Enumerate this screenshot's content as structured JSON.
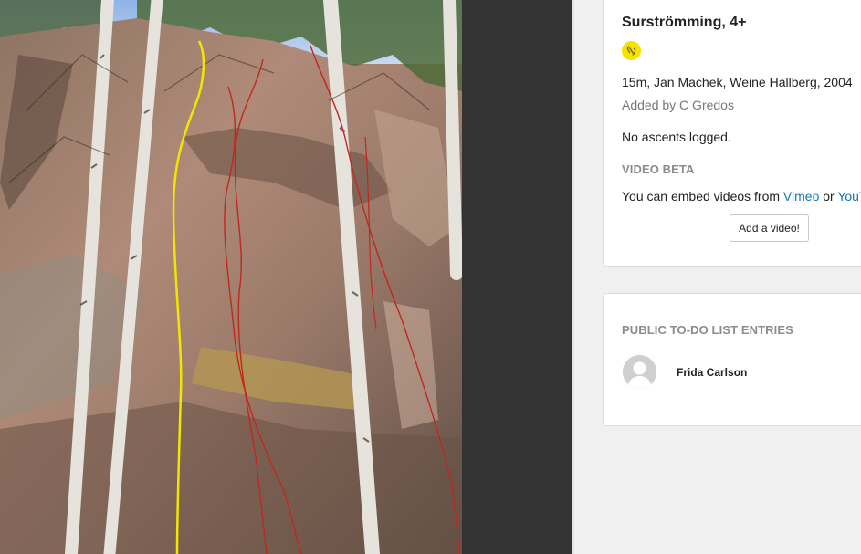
{
  "route": {
    "title": "Surströmming, 4+",
    "grade_icon": "quickdraw-icon",
    "grade_color": "#f3e300",
    "first_ascent": "15m, Jan Machek, Weine Hallberg, 2004",
    "added_by": "Added by C Gredos",
    "ascents": "No ascents logged."
  },
  "video_beta": {
    "heading": "VIDEO BETA",
    "embed_prefix": "You can embed videos from ",
    "vimeo_label": "Vimeo",
    "or_text": " or ",
    "youtube_label": "YouTube",
    "add_button": "Add a video!"
  },
  "todo": {
    "heading": "PUBLIC TO-DO LIST ENTRIES",
    "entries": [
      {
        "name": "Frida Carlson",
        "avatar_icon": "user-avatar-icon"
      }
    ]
  },
  "photo": {
    "highlighted_line_color": "#f2e500",
    "other_line_color": "#c0281e"
  }
}
